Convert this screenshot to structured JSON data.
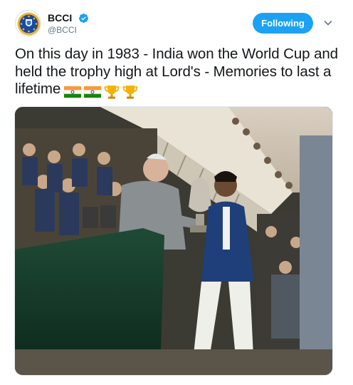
{
  "account": {
    "display_name": "BCCI",
    "handle": "@BCCI",
    "avatar_icon": "bcci-logo-icon",
    "verified_icon": "verified-badge-icon"
  },
  "header": {
    "follow_button_label": "Following",
    "menu_icon": "chevron-down-icon"
  },
  "tweet": {
    "text": "On this day in 1983 - India won the World Cup and held the trophy high at Lord's - Memories to last a lifetime",
    "emojis": [
      "india-flag-icon",
      "india-flag-icon",
      "trophy-icon",
      "trophy-icon"
    ]
  },
  "media": {
    "type": "photo"
  },
  "colors": {
    "accent": "#1da1f2",
    "text_primary": "#14171a",
    "text_secondary": "#657786",
    "flag_saffron": "#ff9933",
    "flag_green": "#138808",
    "trophy_gold": "#f5b301"
  }
}
